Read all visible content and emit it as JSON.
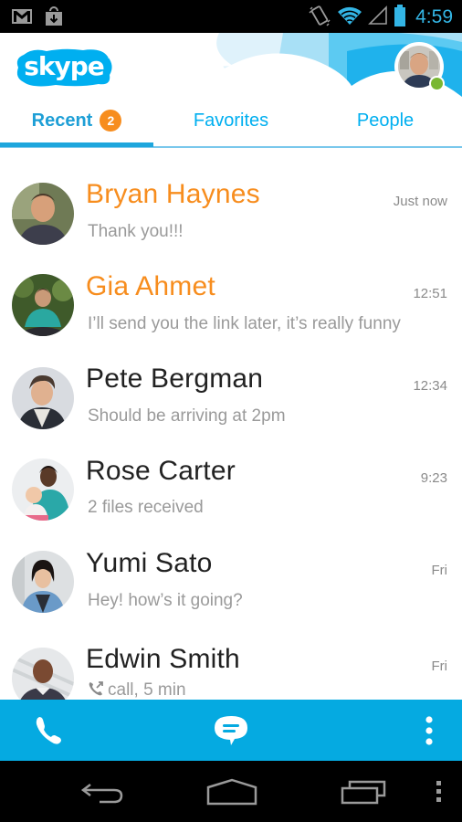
{
  "status_bar": {
    "time": "4:59",
    "left_icons": [
      "gmail-icon",
      "download-icon"
    ],
    "right_icons": [
      "vibrate-icon",
      "wifi-icon",
      "cell-signal-icon",
      "battery-icon"
    ]
  },
  "header": {
    "app_name": "skype",
    "profile": {
      "presence": "online",
      "presence_color": "#7ab733"
    }
  },
  "tabs": [
    {
      "label": "Recent",
      "badge": "2",
      "active": true
    },
    {
      "label": "Favorites",
      "active": false
    },
    {
      "label": "People",
      "active": false
    }
  ],
  "conversations": [
    {
      "name": "Bryan Haynes",
      "message": "Thank you!!!",
      "time": "Just now",
      "unread": true
    },
    {
      "name": "Gia Ahmet",
      "message": "I’ll send you the link later, it’s really funny",
      "time": "12:51",
      "unread": true
    },
    {
      "name": "Pete Bergman",
      "message": "Should be arriving at 2pm",
      "time": "12:34",
      "unread": false
    },
    {
      "name": "Rose Carter",
      "message": "2 files received",
      "time": "9:23",
      "unread": false
    },
    {
      "name": "Yumi Sato",
      "message": "Hey! how’s it going?",
      "time": "Fri",
      "unread": false
    },
    {
      "name": "Edwin Smith",
      "message": "call, 5 min",
      "message_icon": "call-icon",
      "time": "Fri",
      "unread": false
    }
  ],
  "action_bar": {
    "buttons": [
      "call-icon",
      "chat-icon",
      "overflow-menu-icon"
    ]
  },
  "nav_bar": {
    "buttons": [
      "back-icon",
      "home-icon",
      "recent-apps-icon",
      "menu-icon"
    ]
  },
  "colors": {
    "accent": "#00aff0",
    "action_bar": "#05aae1",
    "unread_name": "#f78d1e",
    "badge": "#f78d1e",
    "status_time": "#33b5e5"
  }
}
